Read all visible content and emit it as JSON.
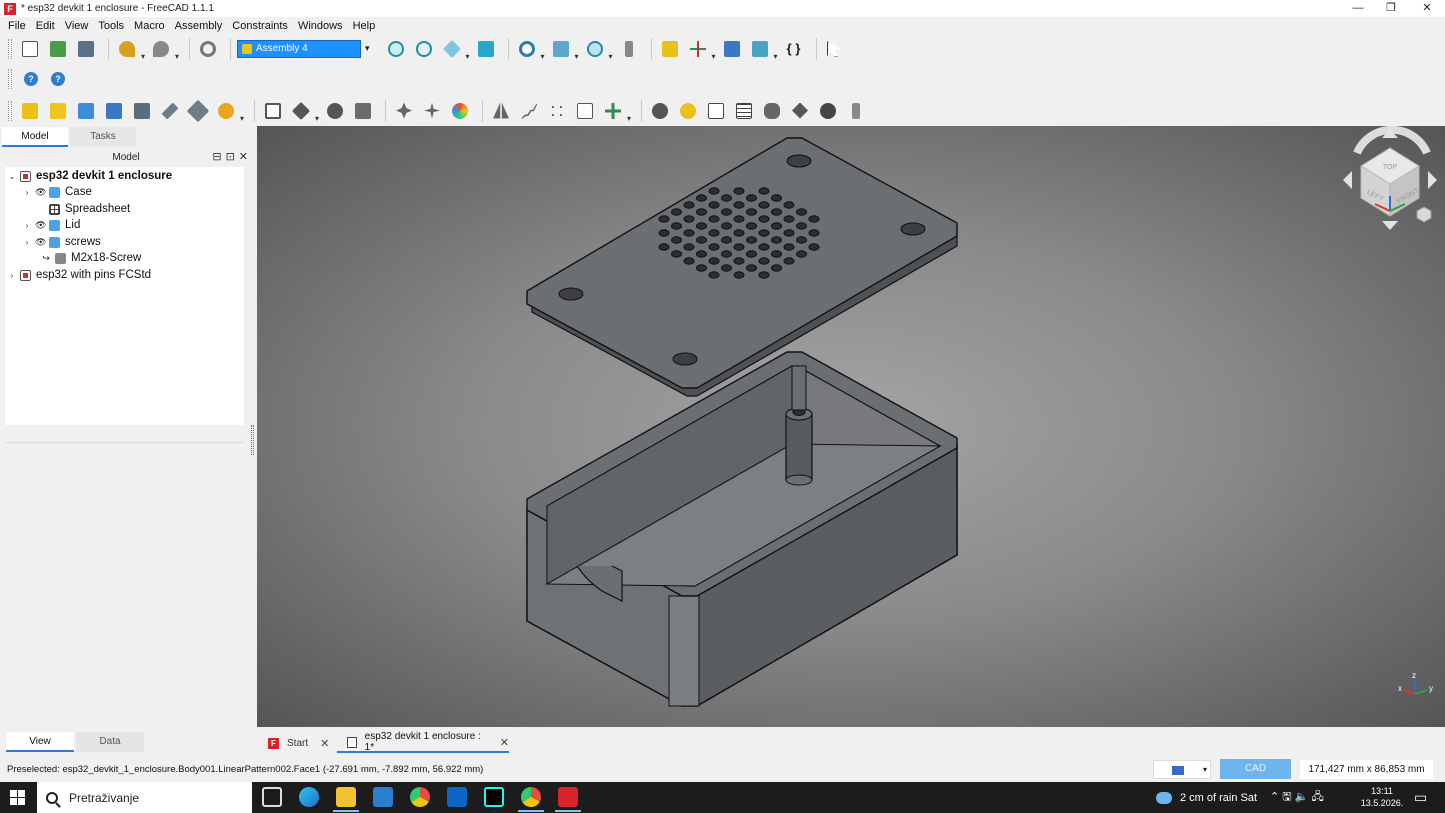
{
  "window": {
    "title": "* esp32 devkit 1 enclosure - FreeCAD 1.1.1",
    "app_icon_letter": "F",
    "minimize": "—",
    "maximize": "❐",
    "close": "✕"
  },
  "menubar": [
    "File",
    "Edit",
    "View",
    "Tools",
    "Macro",
    "Assembly",
    "Constraints",
    "Windows",
    "Help"
  ],
  "toolbar": {
    "workbench": "Assembly 4",
    "dropdown_arrow": "▾",
    "macro_braces": "{ }",
    "help_glyph": "?"
  },
  "left_panel": {
    "tabs": [
      "Model",
      "Tasks"
    ],
    "title": "Model",
    "header_icons": [
      "⊟",
      "⊡",
      "✕"
    ],
    "tree": [
      {
        "label": "esp32 devkit 1 enclosure",
        "expander": "⌄",
        "bold": true
      },
      {
        "label": "Case",
        "expander": "›",
        "visible_glyph": "👁"
      },
      {
        "label": "Spreadsheet"
      },
      {
        "label": "Lid",
        "expander": "›",
        "visible_glyph": "👁"
      },
      {
        "label": "screws",
        "expander": "›",
        "visible_glyph": "👁"
      },
      {
        "label": "M2x18-Screw",
        "link_glyph": "↪"
      },
      {
        "label": "esp32 with pins FCStd",
        "expander": "›"
      }
    ],
    "bottom_tabs": [
      "View",
      "Data"
    ]
  },
  "doc_tabs": [
    {
      "label": "Start",
      "close": "✕"
    },
    {
      "label": "esp32 devkit 1 enclosure : 1*",
      "close": "✕",
      "active": true
    }
  ],
  "status": {
    "preselection": "Preselected: esp32_devkit_1_enclosure.Body001.LinearPattern002.Face1 (-27.691 mm, -7.892 mm, 56.922 mm)",
    "unit_mode": "CAD",
    "dimensions": "171,427 mm x 86,853 mm",
    "nav_arrow": "▾"
  },
  "navcube": {
    "top": "TOP",
    "left": "LEFT",
    "front": "FRONT",
    "axis_z": "z",
    "axis_x": "x",
    "axis_y": "y"
  },
  "taskbar": {
    "search_placeholder": "Pretraživanje",
    "weather": "2 cm of rain Sat",
    "tray_icons": "⌃  🖫  🔈  🖧",
    "time": "13:11",
    "date": "13.5.2026.",
    "notification_glyph": "▭"
  },
  "colors": {
    "accent": "#2f7dd1",
    "workbench_highlight": "#1e90ff",
    "model_fill": "#6b6e73",
    "model_edge": "#111111"
  }
}
